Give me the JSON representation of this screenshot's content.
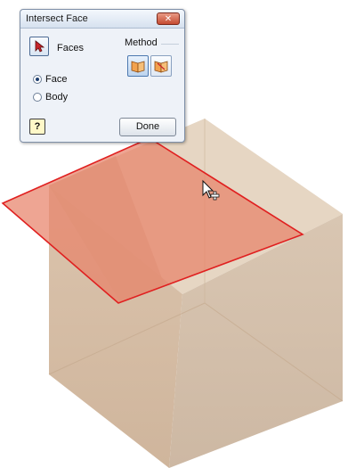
{
  "dialog": {
    "title": "Intersect Face",
    "close_icon_glyph": "✕",
    "faces_label": "Faces",
    "method_label": "Method",
    "radio_options": [
      {
        "label": "Face",
        "selected": true
      },
      {
        "label": "Body",
        "selected": false
      }
    ],
    "help_glyph": "?",
    "done_label": "Done"
  },
  "icons": {
    "faces_select": "arrow-cursor-icon",
    "method_1": "open-book-face-icon",
    "method_2": "open-book-split-icon",
    "help": "help-icon",
    "close": "close-icon",
    "viewport_cursor": "move-cursor-icon"
  },
  "colors": {
    "cube_face": "#d8c2ad",
    "cube_top": "#e6d5c2",
    "highlight_fill": "#e8826a",
    "highlight_stroke": "#e02020",
    "dialog_bg": "#eef2f8",
    "method_icon_orange": "#f0a050"
  }
}
